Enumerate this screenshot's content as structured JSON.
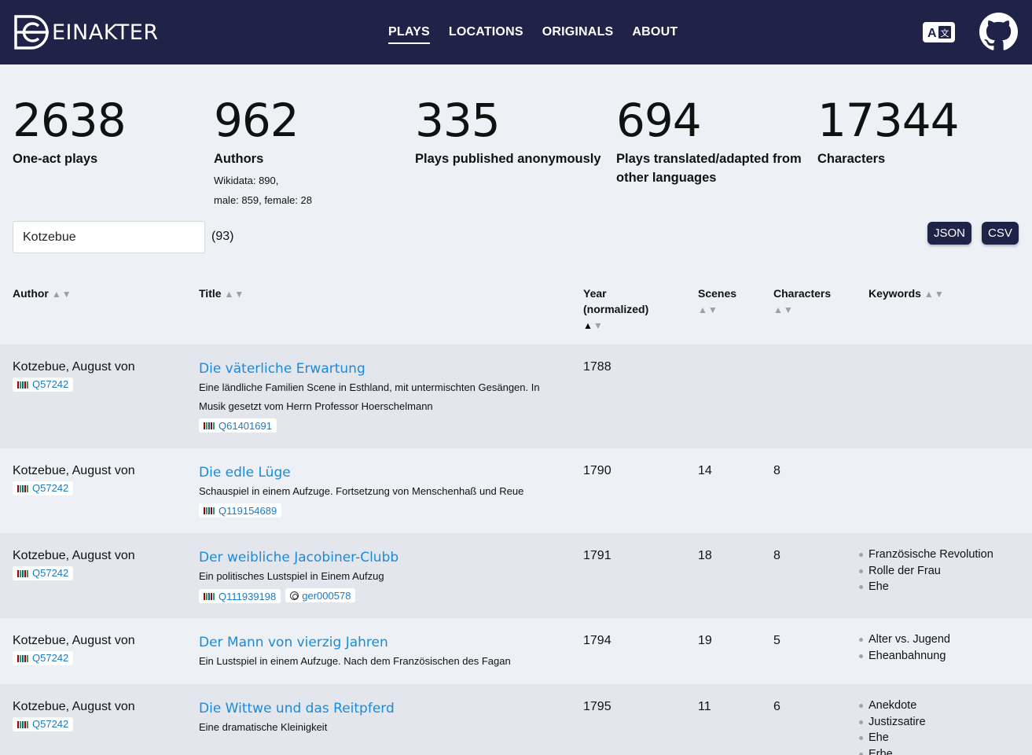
{
  "brand": {
    "name": "EINAKTER"
  },
  "nav": [
    {
      "label": "PLAYS",
      "active": true
    },
    {
      "label": "LOCATIONS",
      "active": false
    },
    {
      "label": "ORIGINALS",
      "active": false
    },
    {
      "label": "ABOUT",
      "active": false
    }
  ],
  "header_icons": {
    "translate": "translate-icon",
    "github": "github-icon"
  },
  "stats": [
    {
      "value": "2638",
      "label": "One-act plays"
    },
    {
      "value": "962",
      "label": "Authors",
      "sub1": "Wikidata: 890,",
      "sub2": "male: 859, female: 28"
    },
    {
      "value": "335",
      "label": "Plays published anonymously"
    },
    {
      "value": "694",
      "label": "Plays translated/adapted from other languages"
    },
    {
      "value": "17344",
      "label": "Characters"
    }
  ],
  "search": {
    "value": "Kotzebue",
    "count": "(93)"
  },
  "downloads": {
    "json": "JSON",
    "csv": "CSV"
  },
  "columns": {
    "author": "Author",
    "title": "Title",
    "year": "Year (normalized)",
    "scenes": "Scenes",
    "characters": "Characters",
    "keywords": "Keywords"
  },
  "sort_arrows": {
    "up": "▲",
    "down": "▼"
  },
  "rows": [
    {
      "author": "Kotzebue, August von",
      "author_wd": "Q57242",
      "title": "Die väterliche Erwartung",
      "subtitle": "Eine ländliche Familien Scene in Esthland, mit untermischten Gesängen. In Musik gesetzt vom Herrn Professor Hoerschelmann",
      "wd": "Q61401691",
      "dracor": "",
      "year": "1788",
      "scenes": "",
      "characters": "",
      "keywords": []
    },
    {
      "author": "Kotzebue, August von",
      "author_wd": "Q57242",
      "title": "Die edle Lüge",
      "subtitle": "Schauspiel in einem Aufzuge. Fortsetzung von Menschenhaß und Reue",
      "wd": "Q119154689",
      "dracor": "",
      "year": "1790",
      "scenes": "14",
      "characters": "8",
      "keywords": []
    },
    {
      "author": "Kotzebue, August von",
      "author_wd": "Q57242",
      "title": "Der weibliche Jacobiner-Clubb",
      "subtitle": "Ein politisches Lustspiel in Einem Aufzug",
      "wd": "Q111939198",
      "dracor": "ger000578",
      "year": "1791",
      "scenes": "18",
      "characters": "8",
      "keywords": [
        "Französische Revolution",
        "Rolle der Frau",
        "Ehe"
      ]
    },
    {
      "author": "Kotzebue, August von",
      "author_wd": "Q57242",
      "title": "Der Mann von vierzig Jahren",
      "subtitle": "Ein Lustspiel in einem Aufzuge. Nach dem Französischen des Fagan",
      "wd": "",
      "dracor": "",
      "year": "1794",
      "scenes": "19",
      "characters": "5",
      "keywords": [
        "Alter vs. Jugend",
        "Eheanbahnung"
      ]
    },
    {
      "author": "Kotzebue, August von",
      "author_wd": "Q57242",
      "title": "Die Wittwe und das Reitpferd",
      "subtitle": "Eine dramatische Kleinigkeit",
      "wd": "",
      "dracor": "",
      "year": "1795",
      "scenes": "11",
      "characters": "6",
      "keywords": [
        "Anekdote",
        "Justizsatire",
        "Ehe",
        "Erbe"
      ]
    }
  ],
  "colors": {
    "header_bg": "#1e2347",
    "link": "#1a8bdb",
    "page_bg": "#edf1f6",
    "row_shade": "#e3e7ed"
  }
}
